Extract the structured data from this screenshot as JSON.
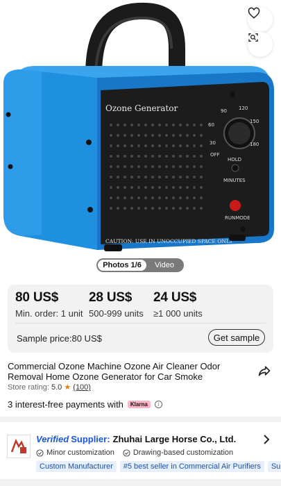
{
  "hero": {
    "product_label": "Ozone Generator",
    "caution_text": "CAUTION: USE IN UNOCCUPIED SPACE ONLY",
    "dial_marks": [
      "OFF",
      "30",
      "60",
      "90",
      "120",
      "150",
      "180",
      "HOLD"
    ],
    "minutes_label": "MINUTES",
    "runmode_label": "RUNMODE",
    "favorite_icon": "heart-icon",
    "image_search_icon": "image-search-icon",
    "media_tabs": [
      {
        "label": "Photos 1/6",
        "active": true
      },
      {
        "label": "Video",
        "active": false
      }
    ]
  },
  "pricing": {
    "tiers": [
      {
        "price": "80 US$",
        "qty": "Min. order: 1 unit"
      },
      {
        "price": "28 US$",
        "qty": "500-999 units"
      },
      {
        "price": "24 US$",
        "qty": "≥1 000 units"
      }
    ],
    "sample_price": "Sample price:80 US$",
    "sample_button": "Get sample"
  },
  "product": {
    "title": "Commercial Ozone Machine Ozone Air Cleaner Odor Removal Home Ozone Generator for Car Smoke",
    "rating_label": "Store rating: ",
    "rating_value": "5.0",
    "rating_star": "★",
    "rating_count": "(100)",
    "installments": "3 interest-free payments with",
    "klarna": "Klarna"
  },
  "supplier": {
    "verified": "Verified",
    "supplier_word": "Supplier:",
    "name": "Zhuhai Large Horse Co., Ltd.",
    "customizations": [
      "Minor customization",
      "Drawing-based customization"
    ],
    "tags": [
      "Custom Manufacturer",
      "#5 best seller in Commercial Air Purifiers",
      "Supplier"
    ]
  },
  "colors": {
    "device_blue": "#1f8fe0",
    "verified_blue": "#1a56db",
    "star_orange": "#f07c00",
    "klarna_pink": "#ffb3c7"
  }
}
